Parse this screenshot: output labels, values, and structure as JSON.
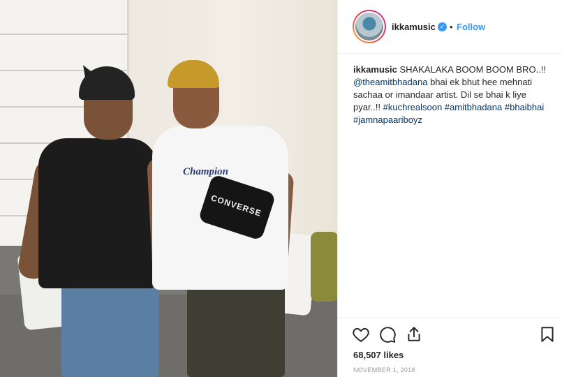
{
  "post": {
    "username": "ikkamusic",
    "follow_label": "Follow",
    "separator": "•",
    "caption": {
      "username": "ikkamusic",
      "text1": "SHAKALAKA BOOM BOOM BRO..!!",
      "mention": "@theamitbhadana",
      "text2": "bhai ek bhut hee mehnati sachaa or imandaar artist. Dil se bhai k liye pyar..!!",
      "hashtags": [
        "#kuchrealsoon",
        "#amitbhadana",
        "#bhaibhai",
        "#jamnapaariboyz"
      ]
    },
    "likes": "68,507 likes",
    "date": "NOVEMBER 1, 2018"
  },
  "photo": {
    "chest_print": "Champion",
    "bag_print": "CONVERSE"
  },
  "icons": {
    "like": "heart-icon",
    "comment": "comment-icon",
    "share": "share-icon",
    "save": "bookmark-icon",
    "verified": "verified-badge-icon"
  },
  "colors": {
    "link": "#003569",
    "follow": "#3897f0",
    "text": "#262626",
    "muted": "#999999"
  }
}
